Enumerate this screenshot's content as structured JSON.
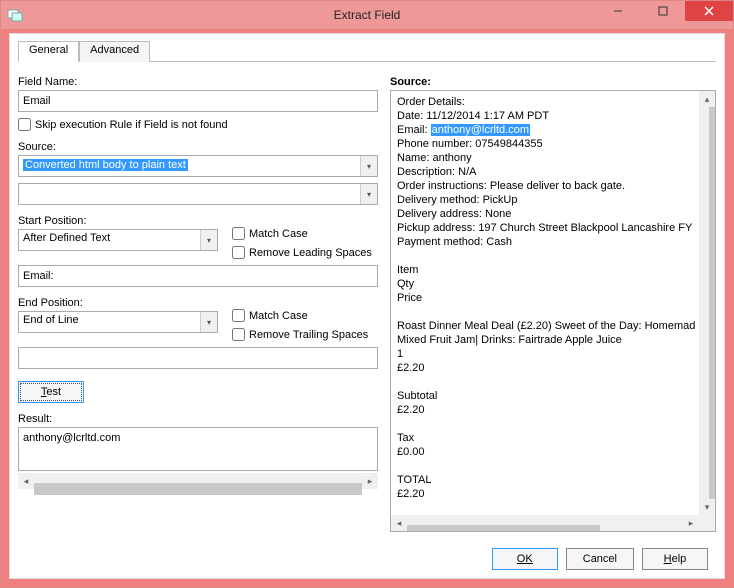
{
  "window": {
    "title": "Extract Field"
  },
  "tabs": {
    "general": "General",
    "advanced": "Advanced"
  },
  "left": {
    "field_name_label": "Field Name:",
    "field_name_value": "Email",
    "skip_label": "Skip execution Rule if Field is not found",
    "skip_checked": false,
    "source_label": "Source:",
    "source_combo1": "Converted html body to plain text",
    "source_combo2": "",
    "start_position_label": "Start Position:",
    "start_position_value": "After Defined Text",
    "start_match_case_label": "Match Case",
    "start_remove_leading_label": "Remove Leading Spaces",
    "start_text": "Email:",
    "end_position_label": "End Position:",
    "end_position_value": "End of Line",
    "end_match_case_label": "Match Case",
    "end_remove_trailing_label": "Remove Trailing Spaces",
    "end_text": "",
    "test_button": "Test",
    "result_label": "Result:",
    "result_value": "anthony@lcrltd.com"
  },
  "right": {
    "source_label": "Source:",
    "highlight_value": "anthony@lcrltd.com",
    "lines": [
      "Order Details:",
      "Date: 11/12/2014 1:17 AM PDT",
      "Email: ",
      "Phone number: 07549844355",
      "Name: anthony",
      "Description: N/A",
      "Order instructions: Please deliver to back gate.",
      "Delivery method: PickUp",
      "Delivery address: None",
      "Pickup address: 197 Church Street Blackpool Lancashire FY",
      "Payment method: Cash",
      "",
      "Item",
      "Qty",
      "Price",
      "",
      "Roast Dinner Meal Deal (£2.20) Sweet of the Day: Homemad",
      "Mixed Fruit Jam| Drinks: Fairtrade Apple Juice",
      "1",
      "£2.20",
      "",
      "Subtotal",
      "£2.20",
      "",
      "Tax",
      "£0.00",
      "",
      "TOTAL",
      "£2.20"
    ]
  },
  "buttons": {
    "ok": "OK",
    "cancel": "Cancel",
    "help": "Help"
  }
}
